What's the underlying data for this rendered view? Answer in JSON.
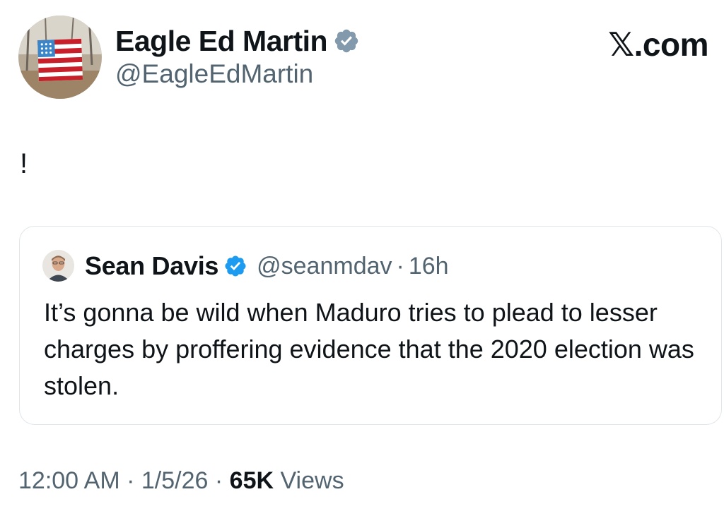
{
  "author": {
    "name": "Eagle Ed Martin",
    "handle": "@EagleEdMartin",
    "avatar_icon": "american-flag-avatar",
    "verified_color": "#829aab"
  },
  "brand": {
    "watermark": "𝕏.com"
  },
  "tweet": {
    "text": "!"
  },
  "quoted_tweet": {
    "author_name": "Sean Davis",
    "author_handle": "@seanmdav",
    "separator": "·",
    "time_ago": "16h",
    "text": "It’s gonna be wild when Maduro tries to plead to lesser charges by proffering evidence that the 2020 election was stolen.",
    "verified_color": "#1d9bf0"
  },
  "meta": {
    "time": "12:00 AM",
    "separator": "·",
    "date": "1/5/26",
    "views_count": "65K",
    "views_label": "Views"
  },
  "colors": {
    "text_primary": "#0f1419",
    "text_secondary": "#536471",
    "border": "#e1e5e8"
  }
}
